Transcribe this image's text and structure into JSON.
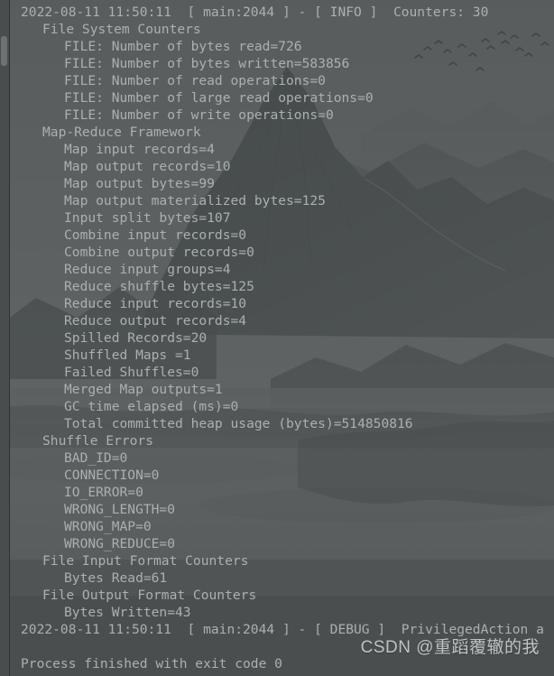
{
  "console": {
    "background_color": "#4b4e4f",
    "text_color": "#a9b1b3",
    "lines": [
      {
        "indent": 0,
        "text": "2022-08-11 11:50:11  [ main:2044 ] - [ INFO ]  Counters: 30"
      },
      {
        "indent": 1,
        "text": "File System Counters"
      },
      {
        "indent": 2,
        "text": "FILE: Number of bytes read=726"
      },
      {
        "indent": 2,
        "text": "FILE: Number of bytes written=583856"
      },
      {
        "indent": 2,
        "text": "FILE: Number of read operations=0"
      },
      {
        "indent": 2,
        "text": "FILE: Number of large read operations=0"
      },
      {
        "indent": 2,
        "text": "FILE: Number of write operations=0"
      },
      {
        "indent": 1,
        "text": "Map-Reduce Framework"
      },
      {
        "indent": 2,
        "text": "Map input records=4"
      },
      {
        "indent": 2,
        "text": "Map output records=10"
      },
      {
        "indent": 2,
        "text": "Map output bytes=99"
      },
      {
        "indent": 2,
        "text": "Map output materialized bytes=125"
      },
      {
        "indent": 2,
        "text": "Input split bytes=107"
      },
      {
        "indent": 2,
        "text": "Combine input records=0"
      },
      {
        "indent": 2,
        "text": "Combine output records=0"
      },
      {
        "indent": 2,
        "text": "Reduce input groups=4"
      },
      {
        "indent": 2,
        "text": "Reduce shuffle bytes=125"
      },
      {
        "indent": 2,
        "text": "Reduce input records=10"
      },
      {
        "indent": 2,
        "text": "Reduce output records=4"
      },
      {
        "indent": 2,
        "text": "Spilled Records=20"
      },
      {
        "indent": 2,
        "text": "Shuffled Maps =1"
      },
      {
        "indent": 2,
        "text": "Failed Shuffles=0"
      },
      {
        "indent": 2,
        "text": "Merged Map outputs=1"
      },
      {
        "indent": 2,
        "text": "GC time elapsed (ms)=0"
      },
      {
        "indent": 2,
        "text": "Total committed heap usage (bytes)=514850816"
      },
      {
        "indent": 1,
        "text": "Shuffle Errors"
      },
      {
        "indent": 2,
        "text": "BAD_ID=0"
      },
      {
        "indent": 2,
        "text": "CONNECTION=0"
      },
      {
        "indent": 2,
        "text": "IO_ERROR=0"
      },
      {
        "indent": 2,
        "text": "WRONG_LENGTH=0"
      },
      {
        "indent": 2,
        "text": "WRONG_MAP=0"
      },
      {
        "indent": 2,
        "text": "WRONG_REDUCE=0"
      },
      {
        "indent": 1,
        "text": "File Input Format Counters"
      },
      {
        "indent": 2,
        "text": "Bytes Read=61"
      },
      {
        "indent": 1,
        "text": "File Output Format Counters"
      },
      {
        "indent": 2,
        "text": "Bytes Written=43"
      },
      {
        "indent": 0,
        "text": "2022-08-11 11:50:11  [ main:2044 ] - [ DEBUG ]  PrivilegedAction a"
      },
      {
        "indent": 0,
        "text": ""
      },
      {
        "indent": 0,
        "text": "Process finished with exit code 0"
      }
    ]
  },
  "gutter": {
    "scroll_thumb_label": "scrollbar-thumb"
  },
  "watermark": {
    "text": "CSDN @重蹈覆辙的我"
  }
}
